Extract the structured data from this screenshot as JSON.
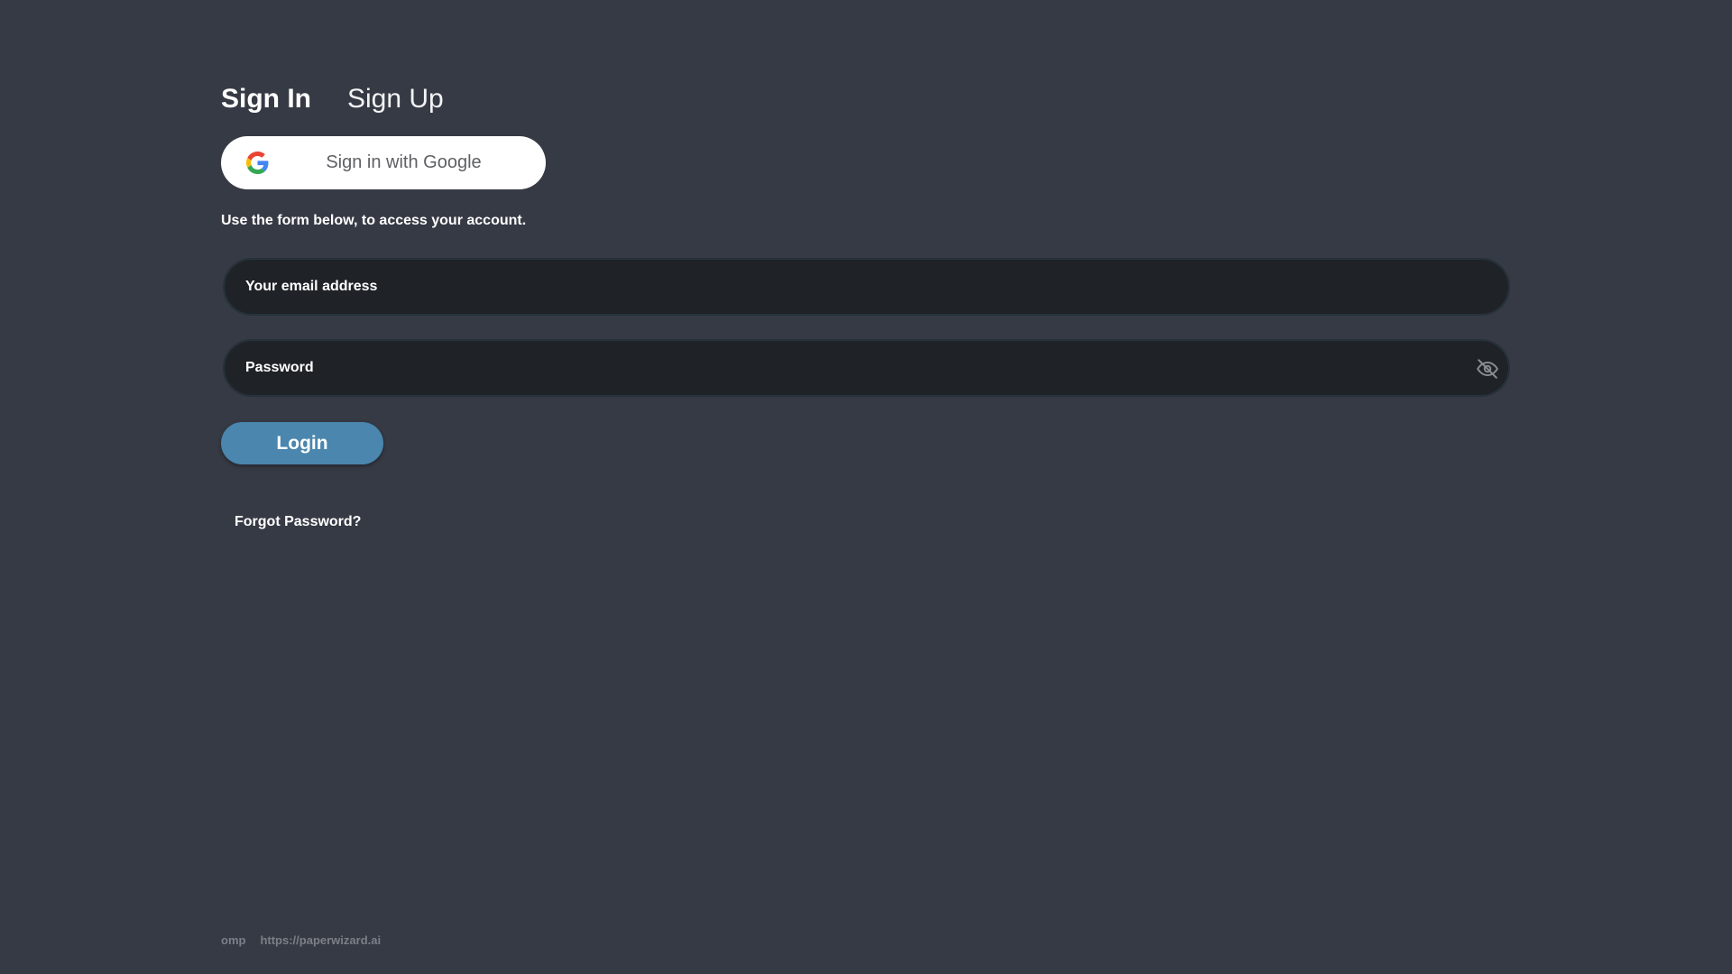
{
  "tabs": {
    "sign_in": "Sign In",
    "sign_up": "Sign Up"
  },
  "google": {
    "label": "Sign in with Google",
    "icon": "google-g-icon"
  },
  "instructions": "Use the form below, to access your account.",
  "email": {
    "placeholder": "Your email address",
    "value": ""
  },
  "password": {
    "placeholder": "Password",
    "value": "",
    "toggle_icon": "eye-slash-icon"
  },
  "login_label": "Login",
  "forgot_label": "Forgot Password?",
  "footer": {
    "left": "omp",
    "link": "https://paperwizard.ai"
  },
  "colors": {
    "background": "#363a44",
    "field_bg": "#1f2328",
    "accent": "#4a86ae"
  }
}
